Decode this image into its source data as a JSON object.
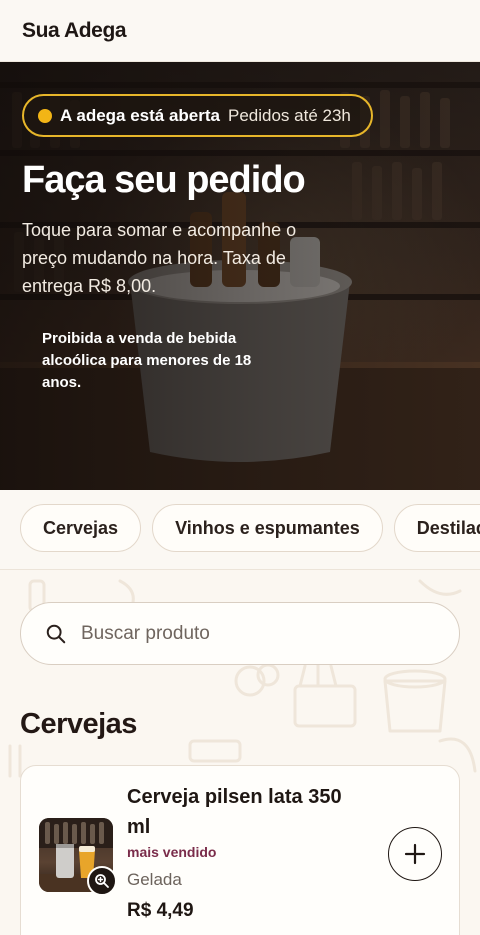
{
  "header": {
    "brand": "Sua Adega"
  },
  "hero": {
    "status_open": "A adega está aberta",
    "status_hours": "Pedidos até 23h",
    "title": "Faça seu pedido",
    "description": "Toque para somar e acompanhe o preço mudando na hora. Taxa de entrega R$ 8,00.",
    "warning": "Proibida a venda de bebida alcoólica para menores de 18 anos."
  },
  "categories": [
    {
      "label": "Cervejas"
    },
    {
      "label": "Vinhos e espumantes"
    },
    {
      "label": "Destilados"
    }
  ],
  "search": {
    "placeholder": "Buscar produto",
    "value": ""
  },
  "section": {
    "title": "Cervejas"
  },
  "products": [
    {
      "name": "Cerveja pilsen lata 350 ml",
      "badge": "mais vendido",
      "description": "Gelada",
      "price": "R$ 4,49"
    }
  ],
  "icons": {
    "status": "status-dot-icon",
    "search": "search-icon",
    "zoom": "zoom-in-icon",
    "add": "plus-icon"
  },
  "colors": {
    "accent": "#e7b62a",
    "background": "#fbf7f1",
    "badge": "#7a2c4a",
    "text": "#231815"
  }
}
